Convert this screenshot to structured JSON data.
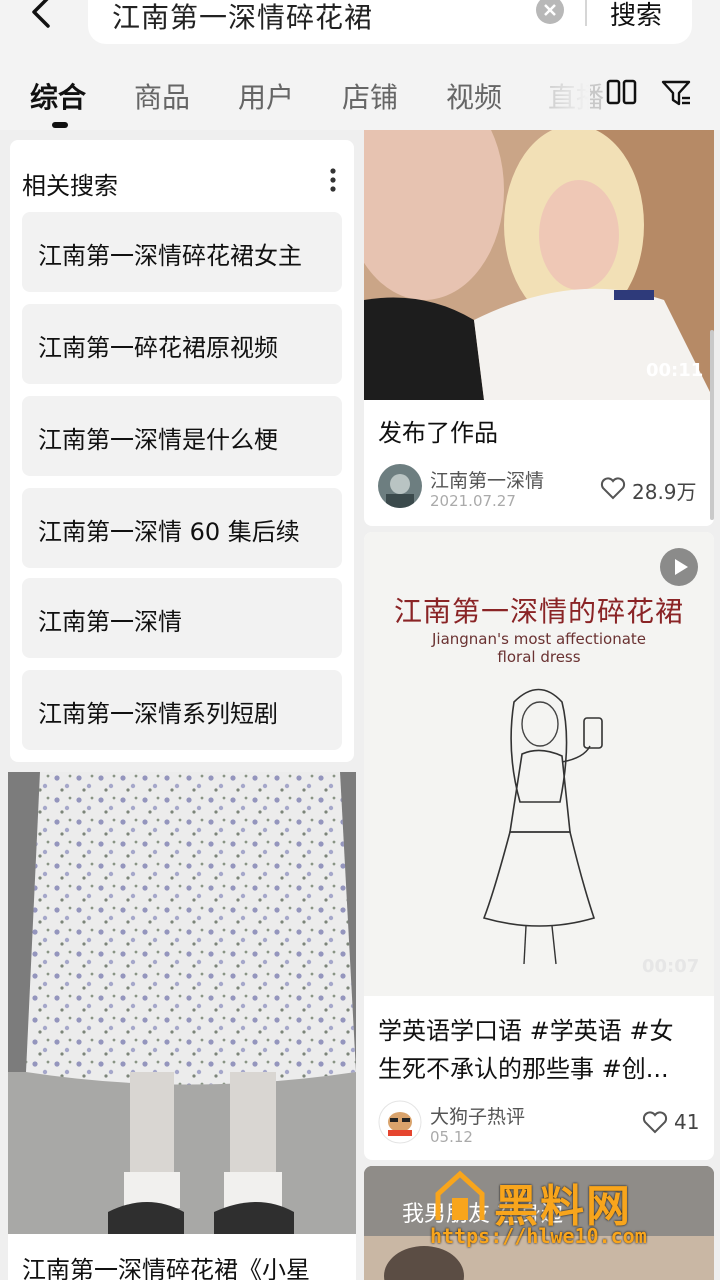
{
  "search": {
    "query": "江南第一深情碎花裙",
    "button_label": "搜索"
  },
  "tabs": [
    {
      "label": "综合",
      "active": true
    },
    {
      "label": "商品",
      "active": false
    },
    {
      "label": "用户",
      "active": false
    },
    {
      "label": "店铺",
      "active": false
    },
    {
      "label": "视频",
      "active": false
    },
    {
      "label": "直播",
      "active": false
    }
  ],
  "icons": {
    "back": "back-arrow-icon",
    "clear": "clear-icon",
    "layout": "two-column-layout-icon",
    "filter": "filter-icon",
    "more": "more-vertical-icon",
    "play": "play-icon",
    "like": "heart-icon"
  },
  "related": {
    "title": "相关搜索",
    "items": [
      "江南第一深情碎花裙女主",
      "江南第一碎花裙原视频",
      "江南第一深情是什么梗",
      "江南第一深情 60 集后续",
      "江南第一深情",
      "江南第一深情系列短剧"
    ]
  },
  "left_post": {
    "title": "江南第一深情碎花裙《小星"
  },
  "video_1": {
    "duration": "00:11",
    "description": "发布了作品",
    "author": "江南第一深情",
    "date": "2021.07.27",
    "likes": "28.9万"
  },
  "video_2": {
    "cover_title_cn": "江南第一深情的碎花裙",
    "cover_title_en_1": "Jiangnan's most affectionate",
    "cover_title_en_2": "floral dress",
    "duration": "00:07",
    "description_line1": "学英语学口语 #学英语 #女",
    "description_line2": "生死不承认的那些事 #创...",
    "author": "大狗子热评",
    "date": "05.12",
    "likes": "41"
  },
  "video_3": {
    "subtitle": "我男朋友 在身边"
  },
  "watermark": {
    "text": "黑料网",
    "url": "https://hlwe10.com"
  },
  "colors": {
    "accent_red": "#8a2426",
    "watermark": "#f8a51c"
  }
}
